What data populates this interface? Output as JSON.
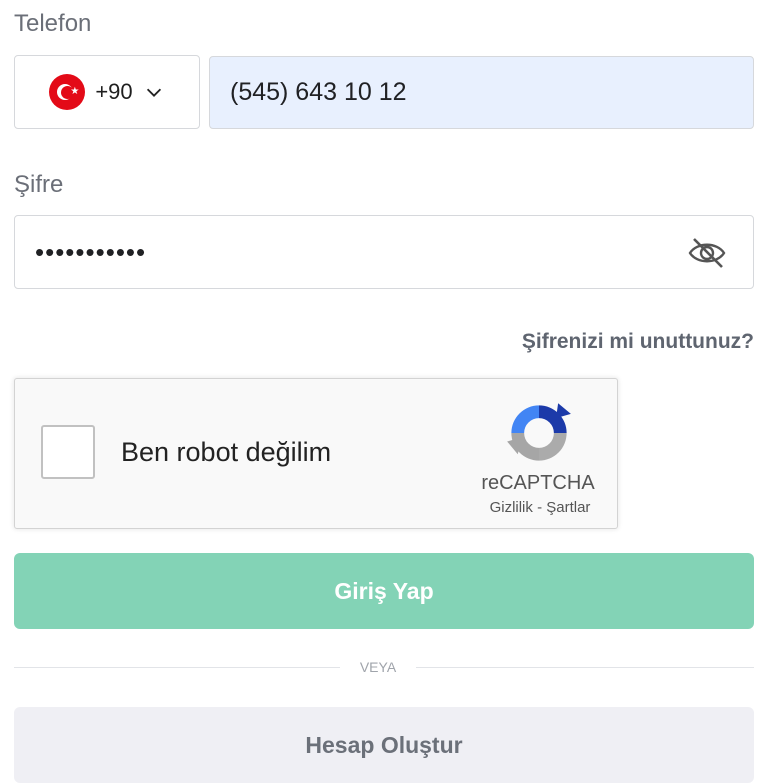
{
  "phone": {
    "label": "Telefon",
    "country_icon": "turkey-flag-icon",
    "dial_code": "+90",
    "value": "(545) 643 10 12"
  },
  "password": {
    "label": "Şifre",
    "value": "•••••••••••",
    "toggle_icon": "eye-slash-icon"
  },
  "forgot_link": "Şifrenizi mi unuttunuz?",
  "recaptcha": {
    "label": "Ben robot değilim",
    "brand": "reCAPTCHA",
    "privacy": "Gizlilik",
    "separator": " - ",
    "terms": "Şartlar"
  },
  "login_button": "Giriş Yap",
  "divider_text": "VEYA",
  "signup_button": "Hesap Oluştur",
  "colors": {
    "primary_button": "#83d3b6",
    "phone_field_bg": "#e8f0fe",
    "secondary_button": "#efeff4"
  }
}
